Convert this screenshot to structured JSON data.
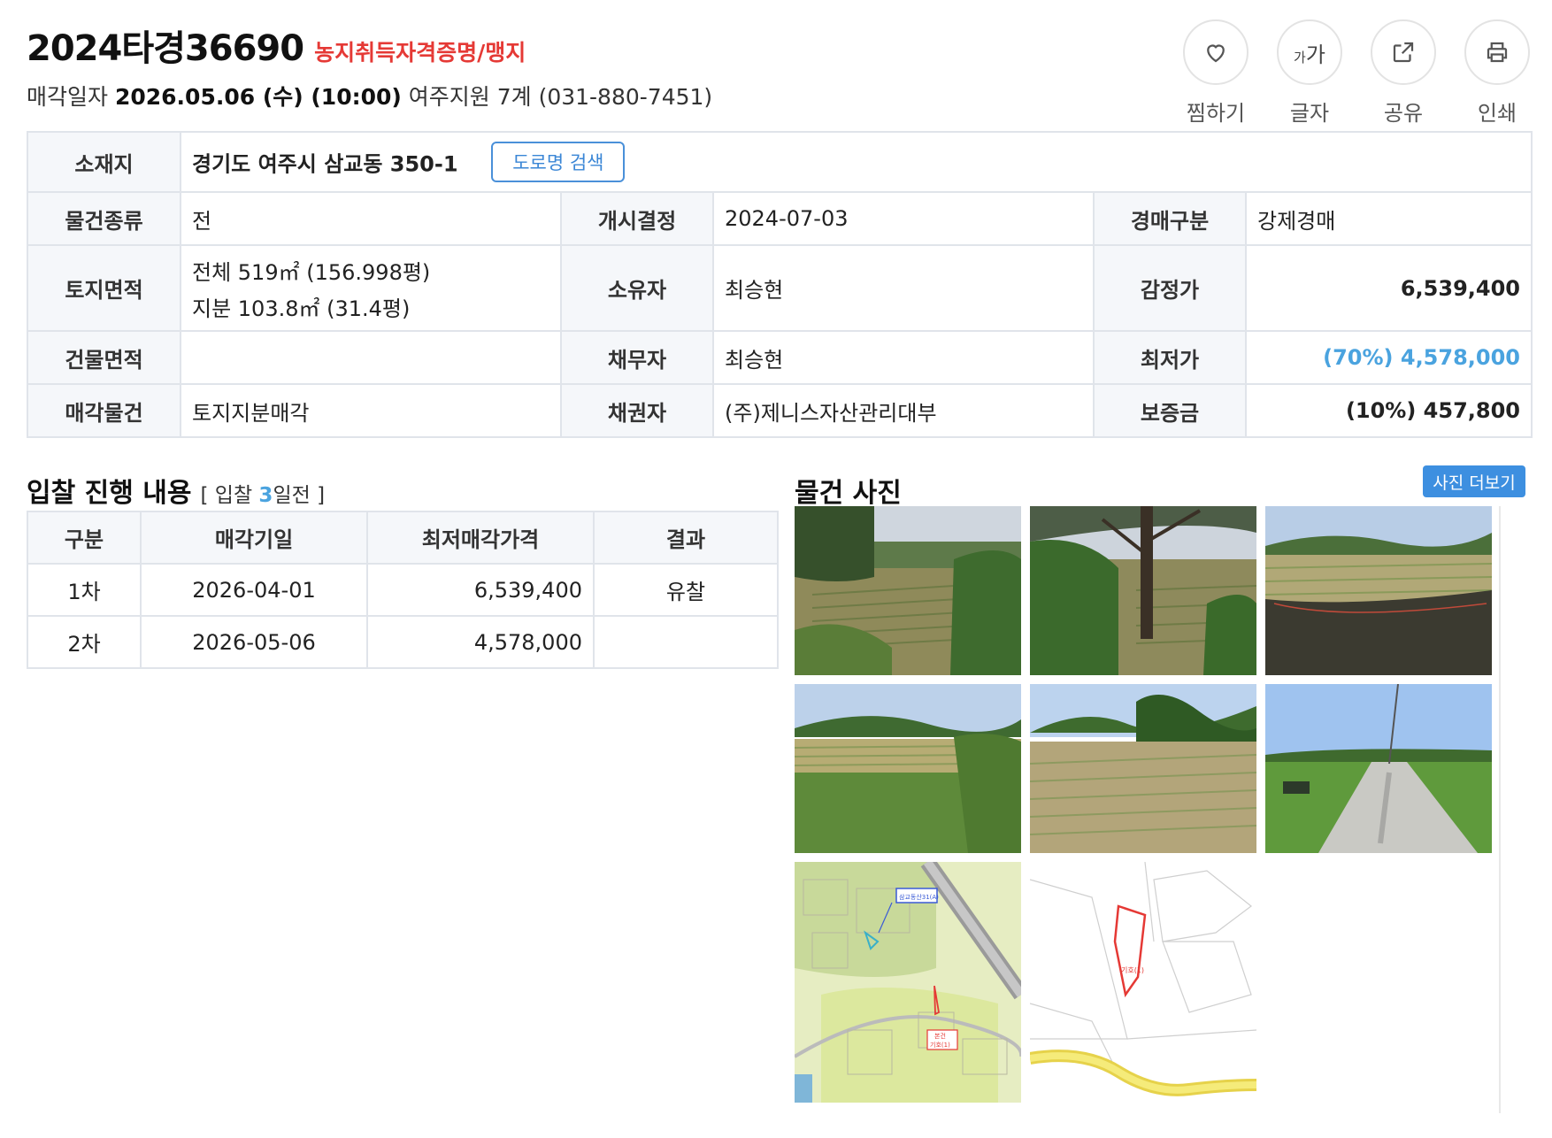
{
  "header": {
    "case_no": "2024타경36690",
    "tag": "농지취득자격증명/맹지",
    "sale_date_label": "매각일자",
    "sale_date_value": "2026.05.06 (수) (10:00)",
    "court": "여주지원 7계 (031-880-7451)"
  },
  "actions": [
    {
      "label": "찜하기",
      "icon": "heart-icon"
    },
    {
      "label": "글자",
      "icon": "font-size-icon",
      "glyph_small": "가",
      "glyph_big": "가"
    },
    {
      "label": "공유",
      "icon": "share-icon"
    },
    {
      "label": "인쇄",
      "icon": "print-icon"
    }
  ],
  "info": {
    "location_label": "소재지",
    "location_value": "경기도 여주시 삼교동 350-1",
    "road_search_button": "도로명 검색",
    "rows": [
      {
        "l1": "물건종류",
        "v1": "전",
        "l2": "개시결정",
        "v2": "2024-07-03",
        "l3": "경매구분",
        "v3": "강제경매"
      },
      {
        "l1": "토지면적",
        "v1a": "전체 519㎡ (156.998평)",
        "v1b": "지분 103.8㎡ (31.4평)",
        "l2": "소유자",
        "v2": "최승현",
        "l3": "감정가",
        "v3": "6,539,400"
      },
      {
        "l1": "건물면적",
        "v1": "",
        "l2": "채무자",
        "v2": "최승현",
        "l3": "최저가",
        "v3": "(70%) 4,578,000"
      },
      {
        "l1": "매각물건",
        "v1": "토지지분매각",
        "l2": "채권자",
        "v2": "(주)제니스자산관리대부",
        "l3": "보증금",
        "v3": "(10%) 457,800"
      }
    ]
  },
  "bid": {
    "title": "입찰 진행 내용",
    "sub_open": "[ 입찰 ",
    "sub_days": "3",
    "sub_close": "일전 ]",
    "columns": [
      "구분",
      "매각기일",
      "최저매각가격",
      "결과"
    ],
    "rows": [
      {
        "round": "1차",
        "date": "2026-04-01",
        "price": "6,539,400",
        "result": "유찰"
      },
      {
        "round": "2차",
        "date": "2026-05-06",
        "price": "4,578,000",
        "result": ""
      }
    ]
  },
  "photos": {
    "title": "물건 사진",
    "more_button": "사진 더보기",
    "map_labels": {
      "a": "삼교동산31(A)",
      "b": "본건",
      "c": "기호(1)"
    }
  },
  "colors": {
    "accent_red": "#e53935",
    "accent_blue": "#4aa3df",
    "button_blue": "#3d8fe0",
    "header_bg": "#f5f7fa",
    "border": "#e0e4ea"
  }
}
